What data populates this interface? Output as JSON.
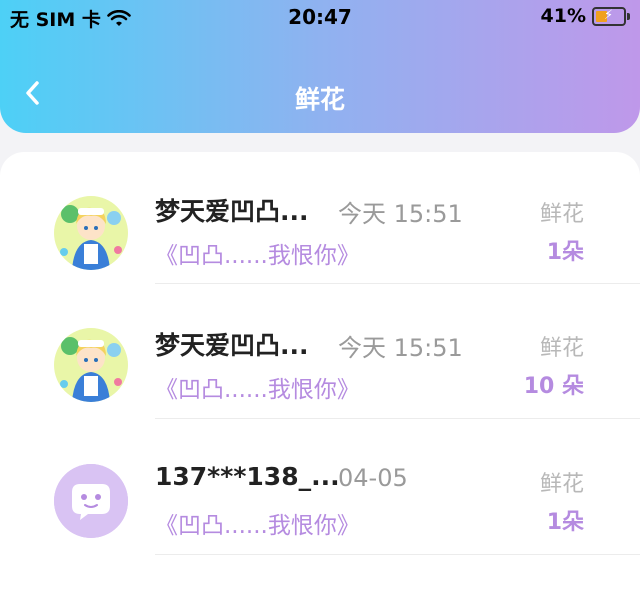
{
  "status_bar": {
    "carrier": "无 SIM 卡",
    "time": "20:47",
    "battery_percent": "41%",
    "battery_level": 0.41,
    "icons": [
      "wifi-icon",
      "battery-charging-icon"
    ]
  },
  "header": {
    "title": "鲜花",
    "back_icon": "chevron-left-icon",
    "gradient_colors": [
      "#4dd0f6",
      "#bf98ea"
    ]
  },
  "accent_color": "#b58be0",
  "rows": [
    {
      "name": "梦天爱凹凸...",
      "time": "今天 15:51",
      "message": "《凹凸......我恨你》",
      "label": "鲜花",
      "count": "1朵",
      "avatar": "anime-avatar"
    },
    {
      "name": "梦天爱凹凸...",
      "time": "今天 15:51",
      "message": "《凹凸......我恨你》",
      "label": "鲜花",
      "count": "10 朵",
      "avatar": "anime-avatar"
    },
    {
      "name": "137***138_...",
      "time": "04-05",
      "message": "《凹凸......我恨你》",
      "label": "鲜花",
      "count": "1朵",
      "avatar": "default-chat-avatar"
    }
  ]
}
